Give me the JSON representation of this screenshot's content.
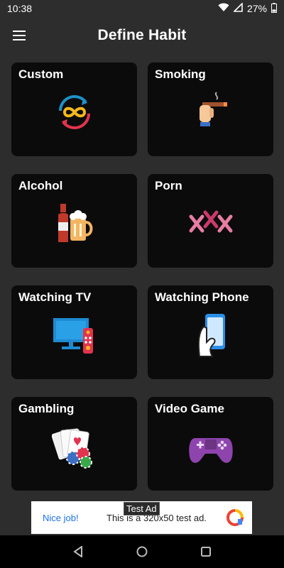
{
  "status_bar": {
    "time": "10:38",
    "battery": "27%",
    "icons": [
      "wifi-icon",
      "signal-icon",
      "battery-icon"
    ]
  },
  "app_bar": {
    "title": "Define Habit",
    "menu_icon": "hamburger-menu-icon"
  },
  "habits": [
    {
      "label": "Custom",
      "icon": "infinity-cycle-icon"
    },
    {
      "label": "Smoking",
      "icon": "cigarette-hand-icon"
    },
    {
      "label": "Alcohol",
      "icon": "beer-bottle-mug-icon"
    },
    {
      "label": "Porn",
      "icon": "xxx-icon"
    },
    {
      "label": "Watching TV",
      "icon": "tv-remote-icon"
    },
    {
      "label": "Watching Phone",
      "icon": "hand-phone-icon"
    },
    {
      "label": "Gambling",
      "icon": "cards-chips-icon"
    },
    {
      "label": "Video Game",
      "icon": "gamepad-icon"
    }
  ],
  "ad": {
    "tag": "Test Ad",
    "headline": "Nice job!",
    "body": "This is a 320x50 test ad."
  },
  "nav_bar": {
    "icons": [
      "back-icon",
      "home-icon",
      "recents-icon"
    ]
  },
  "colors": {
    "background": "#2d2d2d",
    "card": "#0b0b0b",
    "ad_link": "#1a73e8"
  }
}
